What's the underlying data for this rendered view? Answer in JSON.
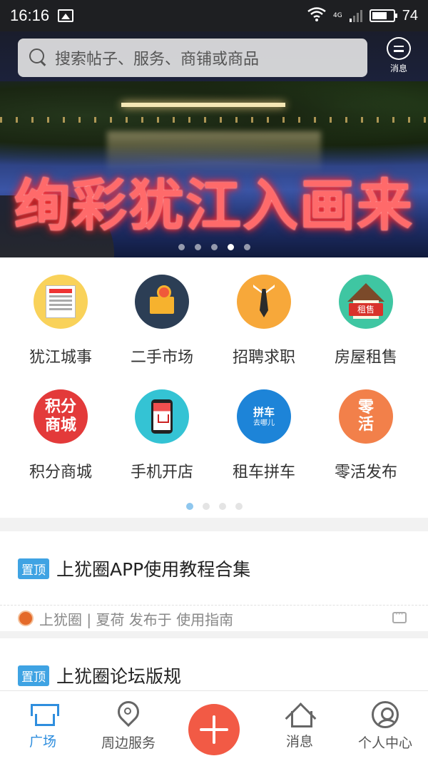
{
  "status_bar": {
    "time": "16:16",
    "network": "4G",
    "battery": "74"
  },
  "search": {
    "placeholder": "搜索帖子、服务、商铺或商品"
  },
  "message_button": {
    "label": "消息"
  },
  "banner": {
    "slogan": "绚彩犹江入画来",
    "page_count": 5,
    "active_page": 4
  },
  "categories": [
    {
      "label": "犹江城事",
      "icon": "newspaper-icon",
      "color": "#f9d25a"
    },
    {
      "label": "二手市场",
      "icon": "box-icon",
      "color": "#2c3e55"
    },
    {
      "label": "招聘求职",
      "icon": "tie-icon",
      "color": "#f7a83a"
    },
    {
      "label": "房屋租售",
      "icon": "house-rent-icon",
      "color": "#3fc6a2",
      "icon_text": "租售"
    },
    {
      "label": "积分商城",
      "icon": "points-mall-icon",
      "color": "#e33a3a",
      "icon_text": "积分商城"
    },
    {
      "label": "手机开店",
      "icon": "phone-shop-icon",
      "color": "#34c3d4"
    },
    {
      "label": "租车拼车",
      "icon": "carpool-icon",
      "color": "#1d84d8",
      "icon_text": "拼车",
      "icon_subtext": "去哪儿"
    },
    {
      "label": "零活发布",
      "icon": "odd-job-icon",
      "color": "#f2804a",
      "icon_text": "零活"
    }
  ],
  "grid_pages": {
    "count": 4,
    "active": 1
  },
  "posts": [
    {
      "tag": "置顶",
      "title": "上犹圈APP使用教程合集",
      "meta": "上犹圈 | 夏荷 发布于 使用指南"
    },
    {
      "tag": "置顶",
      "title": "上犹圈论坛版规"
    }
  ],
  "bottom_nav": {
    "items": [
      {
        "label": "广场",
        "icon": "plaza-icon",
        "active": true
      },
      {
        "label": "周边服务",
        "icon": "location-pin-icon"
      },
      {
        "label": "消息",
        "icon": "house-message-icon"
      },
      {
        "label": "个人中心",
        "icon": "user-icon"
      }
    ],
    "fab_icon": "plus-icon",
    "accent": "#2f8ede",
    "fab_color": "#f25a45"
  }
}
